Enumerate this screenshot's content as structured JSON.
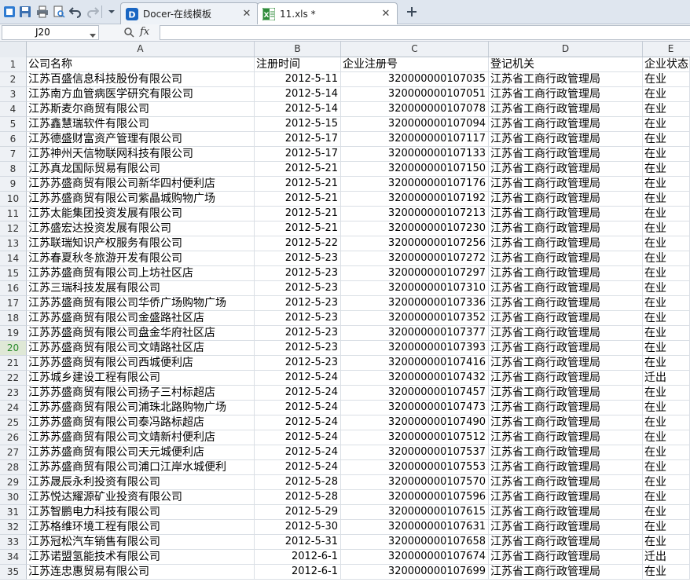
{
  "tabs": [
    {
      "label": "Docer-在线模板",
      "icon": "docer-d-icon",
      "active": false
    },
    {
      "label": "11.xls *",
      "icon": "excel-file-icon",
      "active": true
    }
  ],
  "formula_bar": {
    "name_box": "J20",
    "fx_label": "fx",
    "formula": ""
  },
  "columns": [
    "A",
    "B",
    "C",
    "D",
    "E"
  ],
  "active_row": 20,
  "rows": [
    {
      "n": "1",
      "a": "公司名称",
      "b": "注册时间",
      "c": "企业注册号",
      "d": "登记机关",
      "e": "企业状态"
    },
    {
      "n": "2",
      "a": "江苏百盛信息科技股份有限公司",
      "b": "2012-5-11",
      "c": "320000000107035",
      "d": "江苏省工商行政管理局",
      "e": "在业"
    },
    {
      "n": "3",
      "a": "江苏南方血管病医学研究有限公司",
      "b": "2012-5-14",
      "c": "320000000107051",
      "d": "江苏省工商行政管理局",
      "e": "在业"
    },
    {
      "n": "4",
      "a": "江苏斯麦尔商贸有限公司",
      "b": "2012-5-14",
      "c": "320000000107078",
      "d": "江苏省工商行政管理局",
      "e": "在业"
    },
    {
      "n": "5",
      "a": "江苏鑫慧瑞软件有限公司",
      "b": "2012-5-15",
      "c": "320000000107094",
      "d": "江苏省工商行政管理局",
      "e": "在业"
    },
    {
      "n": "6",
      "a": "江苏德盛财富资产管理有限公司",
      "b": "2012-5-17",
      "c": "320000000107117",
      "d": "江苏省工商行政管理局",
      "e": "在业"
    },
    {
      "n": "7",
      "a": "江苏神州天信物联网科技有限公司",
      "b": "2012-5-17",
      "c": "320000000107133",
      "d": "江苏省工商行政管理局",
      "e": "在业"
    },
    {
      "n": "8",
      "a": "江苏真龙国际贸易有限公司",
      "b": "2012-5-21",
      "c": "320000000107150",
      "d": "江苏省工商行政管理局",
      "e": "在业"
    },
    {
      "n": "9",
      "a": "江苏苏盛商贸有限公司新华四村便利店",
      "b": "2012-5-21",
      "c": "320000000107176",
      "d": "江苏省工商行政管理局",
      "e": "在业"
    },
    {
      "n": "10",
      "a": "江苏苏盛商贸有限公司紫晶城购物广场",
      "b": "2012-5-21",
      "c": "320000000107192",
      "d": "江苏省工商行政管理局",
      "e": "在业"
    },
    {
      "n": "11",
      "a": "江苏太能集团投资发展有限公司",
      "b": "2012-5-21",
      "c": "320000000107213",
      "d": "江苏省工商行政管理局",
      "e": "在业"
    },
    {
      "n": "12",
      "a": "江苏盛宏达投资发展有限公司",
      "b": "2012-5-21",
      "c": "320000000107230",
      "d": "江苏省工商行政管理局",
      "e": "在业"
    },
    {
      "n": "13",
      "a": "江苏联瑞知识产权服务有限公司",
      "b": "2012-5-22",
      "c": "320000000107256",
      "d": "江苏省工商行政管理局",
      "e": "在业"
    },
    {
      "n": "14",
      "a": "江苏春夏秋冬旅游开发有限公司",
      "b": "2012-5-23",
      "c": "320000000107272",
      "d": "江苏省工商行政管理局",
      "e": "在业"
    },
    {
      "n": "15",
      "a": "江苏苏盛商贸有限公司上坊社区店",
      "b": "2012-5-23",
      "c": "320000000107297",
      "d": "江苏省工商行政管理局",
      "e": "在业"
    },
    {
      "n": "16",
      "a": "江苏三瑞科技发展有限公司",
      "b": "2012-5-23",
      "c": "320000000107310",
      "d": "江苏省工商行政管理局",
      "e": "在业"
    },
    {
      "n": "17",
      "a": "江苏苏盛商贸有限公司华侨广场购物广场",
      "b": "2012-5-23",
      "c": "320000000107336",
      "d": "江苏省工商行政管理局",
      "e": "在业"
    },
    {
      "n": "18",
      "a": "江苏苏盛商贸有限公司金盛路社区店",
      "b": "2012-5-23",
      "c": "320000000107352",
      "d": "江苏省工商行政管理局",
      "e": "在业"
    },
    {
      "n": "19",
      "a": "江苏苏盛商贸有限公司盘金华府社区店",
      "b": "2012-5-23",
      "c": "320000000107377",
      "d": "江苏省工商行政管理局",
      "e": "在业"
    },
    {
      "n": "20",
      "a": "江苏苏盛商贸有限公司文靖路社区店",
      "b": "2012-5-23",
      "c": "320000000107393",
      "d": "江苏省工商行政管理局",
      "e": "在业"
    },
    {
      "n": "21",
      "a": "江苏苏盛商贸有限公司西城便利店",
      "b": "2012-5-23",
      "c": "320000000107416",
      "d": "江苏省工商行政管理局",
      "e": "在业"
    },
    {
      "n": "22",
      "a": "江苏城乡建设工程有限公司",
      "b": "2012-5-24",
      "c": "320000000107432",
      "d": "江苏省工商行政管理局",
      "e": "迁出"
    },
    {
      "n": "23",
      "a": "江苏苏盛商贸有限公司扬子三村标超店",
      "b": "2012-5-24",
      "c": "320000000107457",
      "d": "江苏省工商行政管理局",
      "e": "在业"
    },
    {
      "n": "24",
      "a": "江苏苏盛商贸有限公司浦珠北路购物广场",
      "b": "2012-5-24",
      "c": "320000000107473",
      "d": "江苏省工商行政管理局",
      "e": "在业"
    },
    {
      "n": "25",
      "a": "江苏苏盛商贸有限公司泰冯路标超店",
      "b": "2012-5-24",
      "c": "320000000107490",
      "d": "江苏省工商行政管理局",
      "e": "在业"
    },
    {
      "n": "26",
      "a": "江苏苏盛商贸有限公司文靖新村便利店",
      "b": "2012-5-24",
      "c": "320000000107512",
      "d": "江苏省工商行政管理局",
      "e": "在业"
    },
    {
      "n": "27",
      "a": "江苏苏盛商贸有限公司天元城便利店",
      "b": "2012-5-24",
      "c": "320000000107537",
      "d": "江苏省工商行政管理局",
      "e": "在业"
    },
    {
      "n": "28",
      "a": "江苏苏盛商贸有限公司浦口江岸水城便利",
      "b": "2012-5-24",
      "c": "320000000107553",
      "d": "江苏省工商行政管理局",
      "e": "在业"
    },
    {
      "n": "29",
      "a": "江苏晟辰永利投资有限公司",
      "b": "2012-5-28",
      "c": "320000000107570",
      "d": "江苏省工商行政管理局",
      "e": "在业"
    },
    {
      "n": "30",
      "a": "江苏悦达耀源矿业投资有限公司",
      "b": "2012-5-28",
      "c": "320000000107596",
      "d": "江苏省工商行政管理局",
      "e": "在业"
    },
    {
      "n": "31",
      "a": "江苏智鹏电力科技有限公司",
      "b": "2012-5-29",
      "c": "320000000107615",
      "d": "江苏省工商行政管理局",
      "e": "在业"
    },
    {
      "n": "32",
      "a": "江苏格维环境工程有限公司",
      "b": "2012-5-30",
      "c": "320000000107631",
      "d": "江苏省工商行政管理局",
      "e": "在业"
    },
    {
      "n": "33",
      "a": "江苏冠松汽车销售有限公司",
      "b": "2012-5-31",
      "c": "320000000107658",
      "d": "江苏省工商行政管理局",
      "e": "在业"
    },
    {
      "n": "34",
      "a": "江苏诺盟氢能技术有限公司",
      "b": "2012-6-1",
      "c": "320000000107674",
      "d": "江苏省工商行政管理局",
      "e": "迁出"
    },
    {
      "n": "35",
      "a": "江苏连忠惠贸易有限公司",
      "b": "2012-6-1",
      "c": "320000000107699",
      "d": "江苏省工商行政管理局",
      "e": "在业"
    }
  ]
}
